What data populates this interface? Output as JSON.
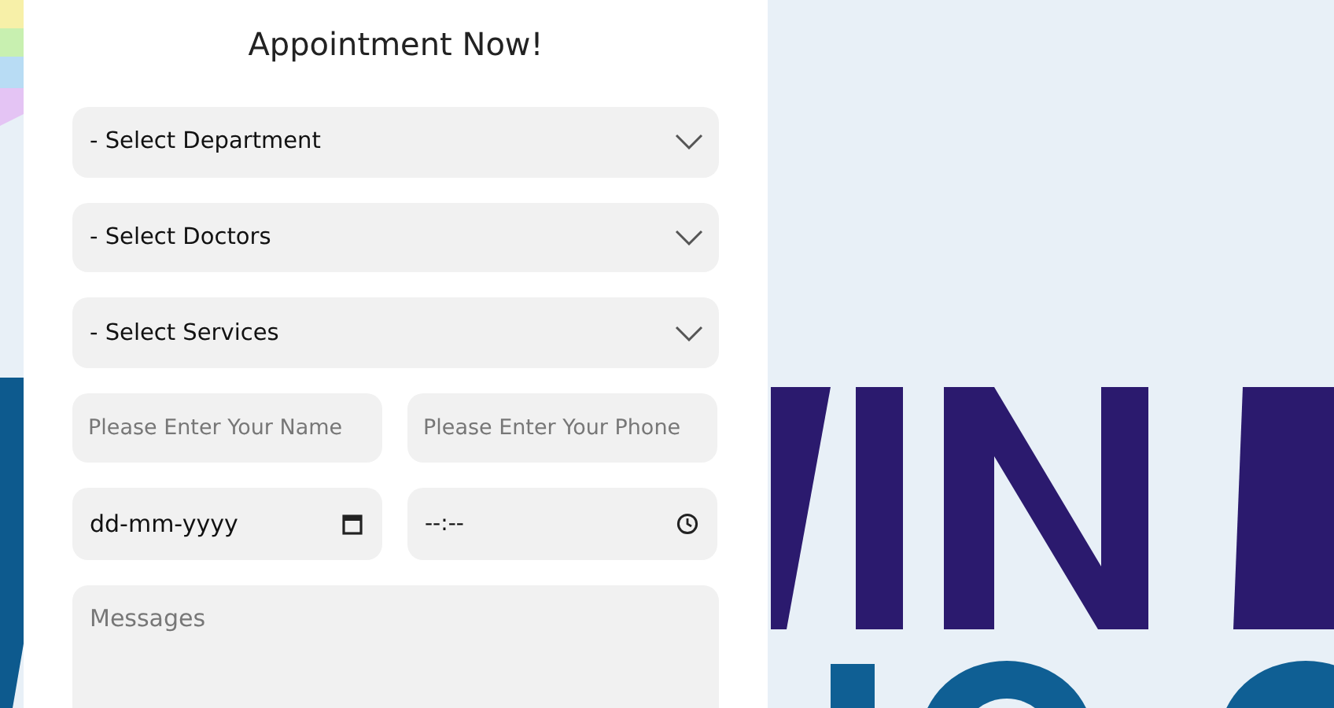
{
  "form": {
    "title": "Appointment Now!",
    "selects": [
      {
        "label": "- Select Department"
      },
      {
        "label": "- Select Doctors"
      },
      {
        "label": "- Select Services"
      }
    ],
    "contact_fields": [
      {
        "placeholder": "Please Enter Your Name"
      },
      {
        "placeholder": "Please Enter Your Phone"
      }
    ],
    "date_field": {
      "value": "dd-mm-yyyy"
    },
    "time_field": {
      "value": "--:--"
    },
    "message_field": {
      "placeholder": "Messages"
    }
  }
}
